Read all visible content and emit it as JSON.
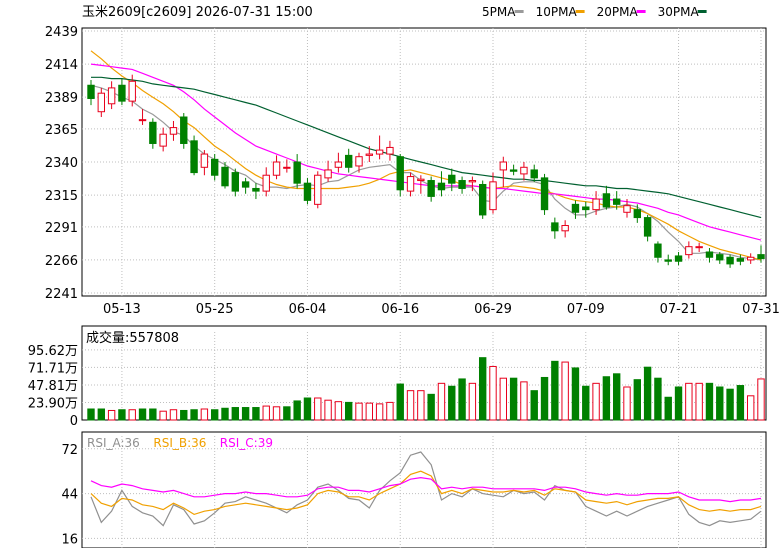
{
  "header": {
    "title": "玉米2609[c2609] 2026-07-31 15:00",
    "legend": [
      {
        "label": "5PMA",
        "color": "#9a9a9a"
      },
      {
        "label": "10PMA",
        "color": "#f0a000"
      },
      {
        "label": "20PMA",
        "color": "#ff00ff"
      },
      {
        "label": "30PMA",
        "color": "#006030"
      }
    ]
  },
  "colors": {
    "up": "#e8001c",
    "down": "#008000",
    "grid": "#bfbfbf",
    "axis": "#000000"
  },
  "chart_data": [
    {
      "type": "candlestick",
      "name_hidden": "",
      "ylim": [
        2241,
        2439
      ],
      "yticks": [
        "2439",
        "2414",
        "2389",
        "2365",
        "2340",
        "2315",
        "2291",
        "2266",
        "2241"
      ],
      "xticks": [
        "05-13",
        "05-25",
        "06-04",
        "06-16",
        "06-29",
        "07-09",
        "07-21",
        "07-31"
      ],
      "xtick_index": [
        3,
        12,
        21,
        30,
        39,
        48,
        57,
        65
      ],
      "candles": [
        [
          2398,
          2388,
          2402,
          2383
        ],
        [
          2378,
          2392,
          2396,
          2374
        ],
        [
          2384,
          2396,
          2401,
          2380
        ],
        [
          2398,
          2386,
          2403,
          2383
        ],
        [
          2386,
          2401,
          2406,
          2382
        ],
        [
          2372,
          2372,
          2380,
          2368
        ],
        [
          2370,
          2354,
          2373,
          2350
        ],
        [
          2352,
          2361,
          2366,
          2348
        ],
        [
          2361,
          2366,
          2371,
          2356
        ],
        [
          2374,
          2354,
          2377,
          2350
        ],
        [
          2356,
          2332,
          2360,
          2330
        ],
        [
          2336,
          2346,
          2349,
          2330
        ],
        [
          2342,
          2330,
          2346,
          2326
        ],
        [
          2336,
          2322,
          2340,
          2320
        ],
        [
          2332,
          2318,
          2335,
          2314
        ],
        [
          2325,
          2321,
          2328,
          2316
        ],
        [
          2320,
          2318,
          2324,
          2312
        ],
        [
          2318,
          2330,
          2336,
          2314
        ],
        [
          2330,
          2340,
          2345,
          2327
        ],
        [
          2336,
          2336,
          2342,
          2332
        ],
        [
          2340,
          2324,
          2346,
          2320
        ],
        [
          2324,
          2311,
          2328,
          2308
        ],
        [
          2308,
          2330,
          2333,
          2305
        ],
        [
          2328,
          2334,
          2341,
          2325
        ],
        [
          2336,
          2340,
          2347,
          2332
        ],
        [
          2345,
          2336,
          2350,
          2332
        ],
        [
          2337,
          2344,
          2347,
          2332
        ],
        [
          2345,
          2346,
          2352,
          2340
        ],
        [
          2346,
          2349,
          2360,
          2342
        ],
        [
          2346,
          2351,
          2356,
          2341
        ],
        [
          2344,
          2319,
          2346,
          2314
        ],
        [
          2318,
          2329,
          2332,
          2314
        ],
        [
          2326,
          2327,
          2330,
          2316
        ],
        [
          2326,
          2314,
          2329,
          2310
        ],
        [
          2324,
          2319,
          2333,
          2314
        ],
        [
          2330,
          2324,
          2335,
          2318
        ],
        [
          2326,
          2320,
          2329,
          2316
        ],
        [
          2325,
          2326,
          2329,
          2318
        ],
        [
          2323,
          2300,
          2326,
          2297
        ],
        [
          2304,
          2325,
          2332,
          2301
        ],
        [
          2334,
          2340,
          2344,
          2321
        ],
        [
          2334,
          2333,
          2338,
          2330
        ],
        [
          2331,
          2336,
          2340,
          2326
        ],
        [
          2334,
          2328,
          2338,
          2325
        ],
        [
          2328,
          2304,
          2331,
          2300
        ],
        [
          2294,
          2288,
          2298,
          2282
        ],
        [
          2288,
          2292,
          2296,
          2283
        ],
        [
          2308,
          2302,
          2311,
          2297
        ],
        [
          2306,
          2304,
          2310,
          2298
        ],
        [
          2304,
          2312,
          2318,
          2300
        ],
        [
          2316,
          2306,
          2322,
          2304
        ],
        [
          2312,
          2308,
          2318,
          2304
        ],
        [
          2302,
          2307,
          2312,
          2298
        ],
        [
          2304,
          2298,
          2308,
          2294
        ],
        [
          2298,
          2284,
          2300,
          2280
        ],
        [
          2278,
          2268,
          2280,
          2264
        ],
        [
          2266,
          2265,
          2270,
          2262
        ],
        [
          2269,
          2265,
          2272,
          2262
        ],
        [
          2270,
          2276,
          2280,
          2267
        ],
        [
          2276,
          2276,
          2279,
          2272
        ],
        [
          2272,
          2268,
          2275,
          2264
        ],
        [
          2270,
          2266,
          2272,
          2263
        ],
        [
          2268,
          2263,
          2270,
          2260
        ],
        [
          2267,
          2265,
          2270,
          2262
        ],
        [
          2266,
          2268,
          2271,
          2263
        ],
        [
          2270,
          2267,
          2277,
          2264
        ]
      ],
      "ma": {
        "5PMA": [
          2398,
          2396,
          2393,
          2389,
          2386,
          2380,
          2376,
          2370,
          2363,
          2360,
          2352,
          2346,
          2342,
          2338,
          2333,
          2330,
          2324,
          2321,
          2321,
          2320,
          2322,
          2323,
          2322,
          2325,
          2326,
          2330,
          2334,
          2336,
          2337,
          2338,
          2332,
          2332,
          2326,
          2322,
          2320,
          2321,
          2321,
          2321,
          2311,
          2310,
          2318,
          2324,
          2325,
          2325,
          2323,
          2312,
          2305,
          2300,
          2300,
          2303,
          2305,
          2306,
          2308,
          2306,
          2301,
          2295,
          2287,
          2280,
          2271,
          2271,
          2272,
          2271,
          2270,
          2268,
          2267,
          2266
        ],
        "10PMA": [
          2424,
          2418,
          2411,
          2405,
          2400,
          2394,
          2389,
          2384,
          2378,
          2371,
          2366,
          2359,
          2352,
          2347,
          2341,
          2335,
          2330,
          2326,
          2323,
          2321,
          2320,
          2320,
          2320,
          2320,
          2320,
          2321,
          2322,
          2324,
          2327,
          2331,
          2333,
          2334,
          2332,
          2330,
          2328,
          2326,
          2323,
          2322,
          2321,
          2320,
          2321,
          2322,
          2321,
          2320,
          2318,
          2316,
          2313,
          2311,
          2310,
          2309,
          2307,
          2306,
          2306,
          2304,
          2301,
          2297,
          2293,
          2288,
          2284,
          2280,
          2277,
          2274,
          2272,
          2270,
          2268,
          2266
        ],
        "20PMA": [
          2414,
          2413,
          2412,
          2411,
          2410,
          2407,
          2404,
          2401,
          2398,
          2393,
          2387,
          2380,
          2374,
          2368,
          2362,
          2357,
          2352,
          2349,
          2346,
          2343,
          2340,
          2337,
          2335,
          2333,
          2331,
          2330,
          2329,
          2328,
          2327,
          2326,
          2325,
          2324,
          2323,
          2322,
          2322,
          2322,
          2322,
          2322,
          2321,
          2320,
          2320,
          2319,
          2318,
          2317,
          2316,
          2316,
          2315,
          2314,
          2313,
          2312,
          2312,
          2311,
          2310,
          2309,
          2307,
          2305,
          2302,
          2300,
          2297,
          2294,
          2291,
          2289,
          2287,
          2285,
          2283,
          2281
        ],
        "30PMA": [
          2404,
          2404,
          2403,
          2403,
          2402,
          2401,
          2399,
          2398,
          2397,
          2396,
          2395,
          2393,
          2391,
          2389,
          2387,
          2385,
          2383,
          2380,
          2377,
          2374,
          2371,
          2368,
          2365,
          2362,
          2359,
          2356,
          2353,
          2350,
          2348,
          2346,
          2344,
          2342,
          2340,
          2338,
          2336,
          2334,
          2332,
          2331,
          2330,
          2329,
          2328,
          2327,
          2327,
          2326,
          2326,
          2325,
          2324,
          2323,
          2322,
          2322,
          2321,
          2320,
          2320,
          2319,
          2318,
          2317,
          2316,
          2314,
          2312,
          2310,
          2308,
          2306,
          2304,
          2302,
          2300,
          2298
        ]
      }
    },
    {
      "type": "bar",
      "title": "成交量:557808",
      "ylim": [
        0,
        1200000
      ],
      "yticks": [
        "95.62万",
        "71.71万",
        "47.81万",
        "23.90万",
        "0"
      ],
      "ytick_values": [
        956200,
        717100,
        478100,
        239000,
        0
      ],
      "values": [
        150000,
        150000,
        130000,
        140000,
        140000,
        150000,
        150000,
        120000,
        140000,
        130000,
        140000,
        150000,
        140000,
        160000,
        170000,
        170000,
        170000,
        190000,
        180000,
        180000,
        260000,
        300000,
        300000,
        270000,
        250000,
        240000,
        230000,
        230000,
        220000,
        240000,
        490000,
        400000,
        400000,
        350000,
        500000,
        460000,
        560000,
        500000,
        850000,
        730000,
        570000,
        570000,
        520000,
        400000,
        580000,
        800000,
        790000,
        710000,
        460000,
        500000,
        590000,
        630000,
        450000,
        550000,
        720000,
        570000,
        310000,
        450000,
        500000,
        500000,
        500000,
        450000,
        420000,
        470000,
        330000,
        560000
      ],
      "up": [
        false,
        false,
        true,
        false,
        true,
        false,
        false,
        true,
        true,
        false,
        false,
        true,
        false,
        false,
        false,
        false,
        false,
        true,
        true,
        false,
        false,
        false,
        true,
        true,
        true,
        false,
        true,
        true,
        true,
        true,
        false,
        true,
        true,
        false,
        true,
        false,
        false,
        true,
        false,
        true,
        true,
        false,
        true,
        false,
        false,
        false,
        true,
        false,
        false,
        true,
        false,
        false,
        true,
        false,
        false,
        false,
        false,
        false,
        true,
        true,
        false,
        false,
        false,
        false,
        true,
        true
      ]
    },
    {
      "type": "line",
      "legend": [
        "RSI_A:36",
        "RSI_B:36",
        "RSI_C:39"
      ],
      "ylim": [
        10,
        80
      ],
      "yticks": [
        "72",
        "44",
        "16"
      ],
      "ytick_values": [
        72,
        44,
        16
      ],
      "series": [
        {
          "name": "RSI_A:36",
          "color": "#909090",
          "values": [
            42,
            26,
            33,
            46,
            36,
            32,
            30,
            24,
            37,
            34,
            25,
            27,
            32,
            38,
            39,
            42,
            40,
            38,
            35,
            32,
            37,
            40,
            48,
            50,
            46,
            41,
            40,
            35,
            46,
            52,
            57,
            68,
            70,
            62,
            40,
            44,
            42,
            47,
            44,
            43,
            42,
            46,
            44,
            45,
            40,
            49,
            46,
            45,
            36,
            33,
            30,
            33,
            30,
            33,
            36,
            38,
            40,
            42,
            31,
            26,
            24,
            27,
            26,
            27,
            28,
            33
          ]
        },
        {
          "name": "RSI_B:36",
          "color": "#f0a000",
          "values": [
            44,
            38,
            36,
            41,
            40,
            37,
            36,
            34,
            38,
            35,
            31,
            33,
            34,
            36,
            37,
            38,
            37,
            36,
            35,
            34,
            35,
            37,
            44,
            46,
            45,
            42,
            42,
            40,
            44,
            47,
            50,
            56,
            58,
            55,
            44,
            46,
            44,
            47,
            46,
            45,
            45,
            46,
            45,
            46,
            43,
            47,
            46,
            45,
            40,
            39,
            38,
            39,
            37,
            39,
            40,
            41,
            41,
            42,
            37,
            34,
            33,
            34,
            33,
            34,
            34,
            36
          ]
        },
        {
          "name": "RSI_C:39",
          "color": "#ff00ff",
          "values": [
            52,
            49,
            48,
            50,
            49,
            47,
            46,
            45,
            46,
            44,
            42,
            42,
            43,
            44,
            44,
            45,
            44,
            44,
            43,
            42,
            42,
            43,
            47,
            48,
            48,
            46,
            46,
            45,
            47,
            49,
            50,
            53,
            54,
            53,
            47,
            48,
            47,
            48,
            48,
            47,
            47,
            47,
            47,
            47,
            46,
            48,
            48,
            47,
            45,
            44,
            43,
            44,
            43,
            43,
            44,
            44,
            44,
            45,
            42,
            40,
            40,
            40,
            39,
            40,
            40,
            41
          ]
        }
      ]
    }
  ]
}
